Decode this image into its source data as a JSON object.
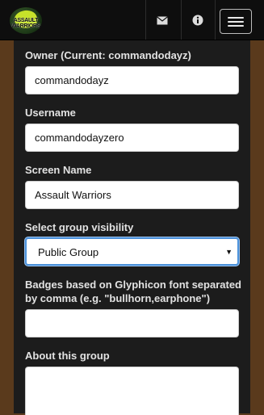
{
  "navbar": {
    "logo_text": "ASSAULT WARRIORS",
    "icons": [
      "envelope-icon",
      "info-icon"
    ],
    "menu_toggle": "hamburger-menu-icon"
  },
  "form": {
    "owner": {
      "label": "Owner (Current: commandodayz)",
      "value": "commandodayz"
    },
    "username": {
      "label": "Username",
      "value": "commandodayzero"
    },
    "screen_name": {
      "label": "Screen Name",
      "value": "Assault Warriors"
    },
    "visibility": {
      "label": "Select group visibility",
      "selected": "Public Group"
    },
    "badges": {
      "label": "Badges based on Glyphicon font separated by comma (e.g. \"bullhorn,earphone\")",
      "value": ""
    },
    "about": {
      "label": "About this group",
      "value": ""
    }
  },
  "colors": {
    "page_background": "#5a3a1c",
    "navbar": "#0e0e0e",
    "panel": "#1c1c1c",
    "focus_border": "#4a90d9"
  }
}
